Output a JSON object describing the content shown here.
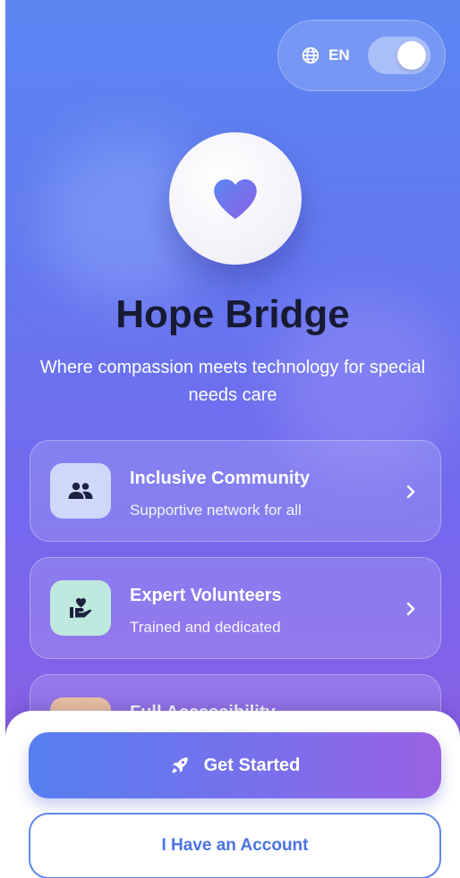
{
  "colors": {
    "accent": "#5b86f2",
    "accent_purple": "#9a60e2",
    "title": "#161a33",
    "secondary_button_text": "#4a74e6"
  },
  "language": {
    "icon": "globe-icon",
    "code": "EN",
    "toggle_on": true
  },
  "app": {
    "logo_icon": "heart-icon",
    "title": "Hope Bridge",
    "tagline": "Where compassion meets technology for special needs care"
  },
  "features": [
    {
      "title": "Inclusive Community",
      "subtitle": "Supportive network for all",
      "icon": "people-icon",
      "icon_bg": "#cfd8fb"
    },
    {
      "title": "Expert Volunteers",
      "subtitle": "Trained and dedicated",
      "icon": "volunteer-hand-heart-icon",
      "icon_bg": "#bfe8de"
    },
    {
      "title": "Full Accessibility",
      "subtitle": "",
      "icon": "accessibility-icon",
      "icon_bg": "#f2c7a4"
    }
  ],
  "actions": {
    "get_started_label": "Get Started",
    "get_started_icon": "rocket-icon",
    "account_label": "I Have an Account"
  }
}
